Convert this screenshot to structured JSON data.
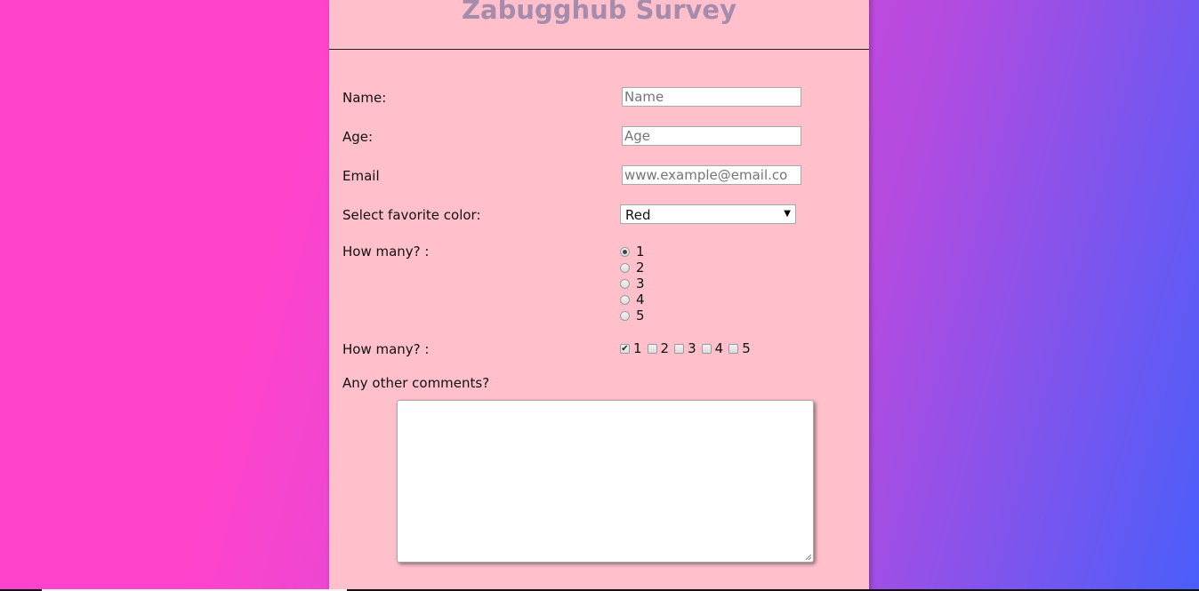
{
  "title": "Zabugghub Survey",
  "fields": {
    "name": {
      "label": "Name:",
      "placeholder": "Name"
    },
    "age": {
      "label": "Age:",
      "placeholder": "Age"
    },
    "email": {
      "label": "Email",
      "placeholder": "www.example@email.co"
    },
    "color": {
      "label": "Select favorite color:",
      "selected": "Red"
    }
  },
  "radio_group": {
    "label": "How many? :",
    "options": [
      "1",
      "2",
      "3",
      "4",
      "5"
    ],
    "selected": "1"
  },
  "checkbox_group": {
    "label": "How many? :",
    "options": [
      "1",
      "2",
      "3",
      "4",
      "5"
    ],
    "checked": [
      "1"
    ]
  },
  "comments": {
    "label": "Any other comments?",
    "value": ""
  }
}
